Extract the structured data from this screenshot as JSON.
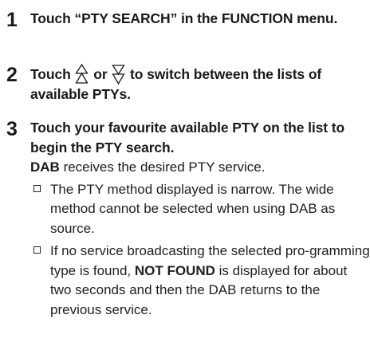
{
  "steps": [
    {
      "number": "1",
      "text": "Touch “PTY SEARCH” in the FUNCTION menu."
    },
    {
      "number": "2",
      "text_before": "Touch ",
      "text_middle": " or ",
      "text_after": " to switch between the lists of available PTYs.",
      "icon_up": "up-arrow-outline-icon",
      "icon_down": "down-arrow-outline-icon"
    },
    {
      "number": "3",
      "text": "Touch your favourite available PTY on the list to begin the PTY search.",
      "result_bold": "DAB",
      "result_rest": " receives the desired PTY service.",
      "notes": [
        {
          "text": "The PTY method displayed is narrow. The wide method cannot be selected when using DAB as source."
        },
        {
          "text_before": "If no service broadcasting the selected pro-gramming type is found, ",
          "bold": "NOT FOUND",
          "text_after": " is displayed for about two seconds and then the DAB returns to the previous service."
        }
      ]
    }
  ]
}
